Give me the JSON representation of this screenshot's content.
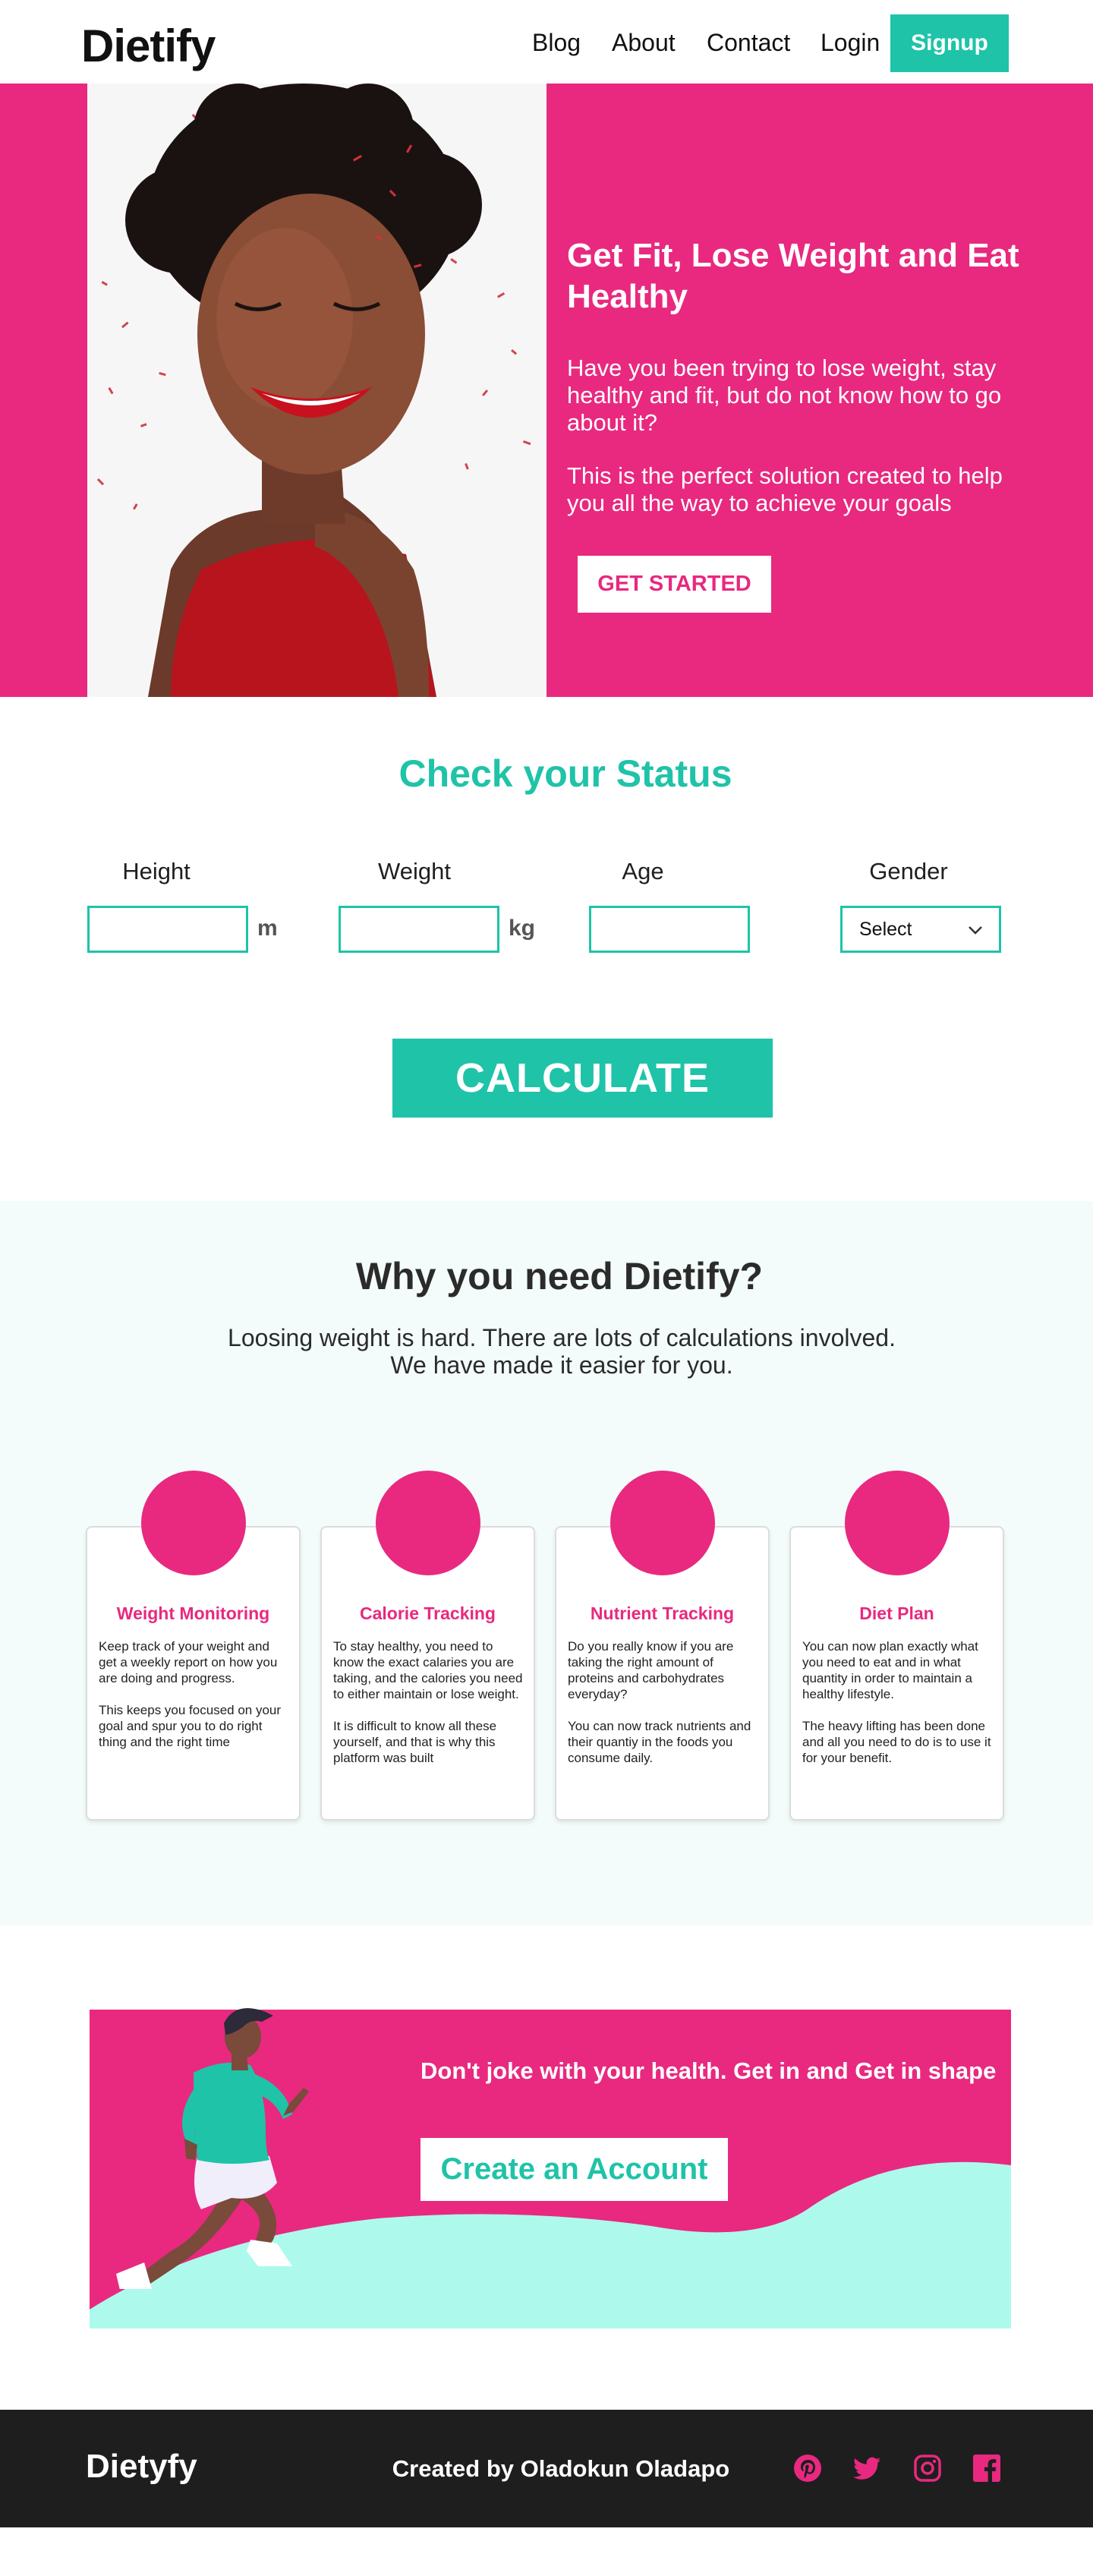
{
  "nav": {
    "logo": "Dietify",
    "links": [
      "Blog",
      "About",
      "Contact",
      "Login"
    ],
    "signup": "Signup"
  },
  "hero": {
    "title": "Get Fit, Lose Weight and Eat Healthy",
    "p1": "Have you been trying to lose weight, stay healthy and fit, but do not know how to go about it?",
    "p2": "This is the perfect solution created to help you all the way to achieve your goals",
    "cta": "GET STARTED"
  },
  "status": {
    "title": "Check your Status",
    "fields": {
      "height": {
        "label": "Height",
        "unit": "m",
        "value": ""
      },
      "weight": {
        "label": "Weight",
        "unit": "kg",
        "value": ""
      },
      "age": {
        "label": "Age",
        "value": ""
      },
      "gender": {
        "label": "Gender",
        "selected": "Select"
      }
    },
    "calculate": "CALCULATE"
  },
  "why": {
    "title": "Why you need Dietify?",
    "subtitle_line1": "Loosing weight is hard. There are lots of  calculations involved.",
    "subtitle_line2": "We have made it easier for you.",
    "cards": [
      {
        "title": "Weight Monitoring",
        "p1": "Keep track of your weight and get a weekly report on how you are doing and progress.",
        "p2": "This keeps you focused on your goal and spur you to do right thing and the right time"
      },
      {
        "title": "Calorie Tracking",
        "p1": "To stay healthy, you need to know the exact calaries you are taking, and the calories you need to either maintain or lose weight.",
        "p2": "It is difficult to know all these yourself, and that is why this platform was built"
      },
      {
        "title": "Nutrient Tracking",
        "p1": "Do you really know if you are taking the right amount of proteins and carbohydrates everyday?",
        "p2": "You can now track nutrients and their quantiy in the foods you consume daily."
      },
      {
        "title": "Diet Plan",
        "p1": "You can now plan exactly what you need to eat and in what quantity in order to maintain a healthy lifestyle.",
        "p2": "The heavy lifting has been done and all you need to do is to use  it for your benefit."
      }
    ]
  },
  "cta": {
    "text": "Don't joke with your health. Get in and Get in shape",
    "button": "Create an Account"
  },
  "footer": {
    "logo": "Dietyfy",
    "credit": "Created by Oladokun Oladapo",
    "social": [
      "pinterest-icon",
      "twitter-icon",
      "instagram-icon",
      "facebook-icon"
    ]
  },
  "colors": {
    "primary_pink": "#e8297f",
    "accent_teal": "#1fc3a8",
    "wave_mint": "#adfaed",
    "footer_bg": "#1e1e1e"
  }
}
